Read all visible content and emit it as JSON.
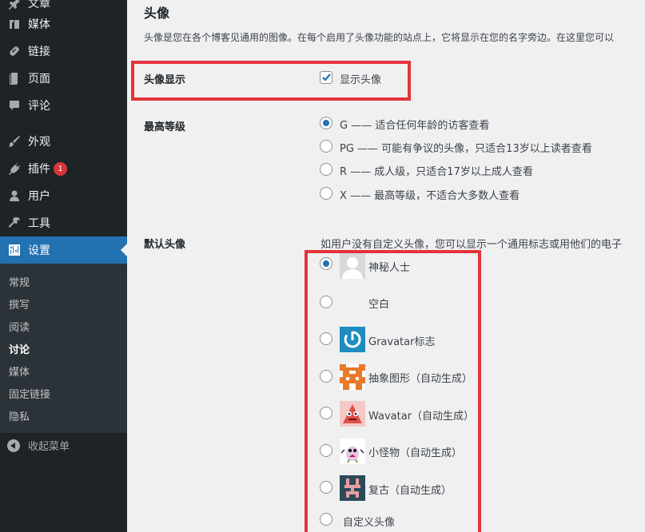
{
  "sidebar": {
    "items": [
      {
        "label": "文章",
        "icon": "pushpin-icon"
      },
      {
        "label": "媒体",
        "icon": "media-icon"
      },
      {
        "label": "链接",
        "icon": "link-icon"
      },
      {
        "label": "页面",
        "icon": "page-icon"
      },
      {
        "label": "评论",
        "icon": "comment-icon"
      },
      {
        "label": "外观",
        "icon": "paintbrush-icon"
      },
      {
        "label": "插件",
        "icon": "plugin-icon",
        "badge": "1"
      },
      {
        "label": "用户",
        "icon": "user-icon"
      },
      {
        "label": "工具",
        "icon": "wrench-icon"
      },
      {
        "label": "设置",
        "icon": "settings-icon"
      }
    ],
    "submenu": [
      "常规",
      "撰写",
      "阅读",
      "讨论",
      "媒体",
      "固定链接",
      "隐私"
    ],
    "current_submenu": "讨论",
    "collapse_label": "收起菜单"
  },
  "main": {
    "title": "头像",
    "description": "头像是您在各个博客见通用的图像。在每个启用了头像功能的站点上，它将显示在您的名字旁边。在这里您可以",
    "show_avatars": {
      "label": "头像显示",
      "checkbox_label": "显示头像",
      "checked": true
    },
    "max_rating": {
      "label": "最高等级",
      "options": [
        {
          "text": "G —— 适合任何年龄的访客查看",
          "checked": true
        },
        {
          "text": "PG —— 可能有争议的头像，只适合13岁以上读者查看",
          "checked": false
        },
        {
          "text": "R —— 成人级，只适合17岁以上成人查看",
          "checked": false
        },
        {
          "text": "X —— 最高等级，不适合大多数人查看",
          "checked": false
        }
      ]
    },
    "default_avatar": {
      "label": "默认头像",
      "description": "如用户没有自定义头像，您可以显示一个通用标志或用他们的电子",
      "options": [
        {
          "text": "神秘人士",
          "icon": "mystery-person-avatar-icon",
          "checked": true
        },
        {
          "text": "空白",
          "icon": "blank-avatar-icon",
          "checked": false
        },
        {
          "text": "Gravatar标志",
          "icon": "gravatar-logo-icon",
          "checked": false
        },
        {
          "text": "抽象图形（自动生成）",
          "icon": "identicon-avatar-icon",
          "checked": false
        },
        {
          "text": "Wavatar（自动生成）",
          "icon": "wavatar-avatar-icon",
          "checked": false
        },
        {
          "text": "小怪物（自动生成）",
          "icon": "monsterid-avatar-icon",
          "checked": false
        },
        {
          "text": "复古（自动生成）",
          "icon": "retro-avatar-icon",
          "checked": false
        },
        {
          "text": "自定义头像",
          "icon": "",
          "checked": false
        }
      ]
    }
  },
  "colors": {
    "sidebar_bg": "#1d2327",
    "active_menu": "#2271b1",
    "highlight_border": "#e3343a"
  }
}
